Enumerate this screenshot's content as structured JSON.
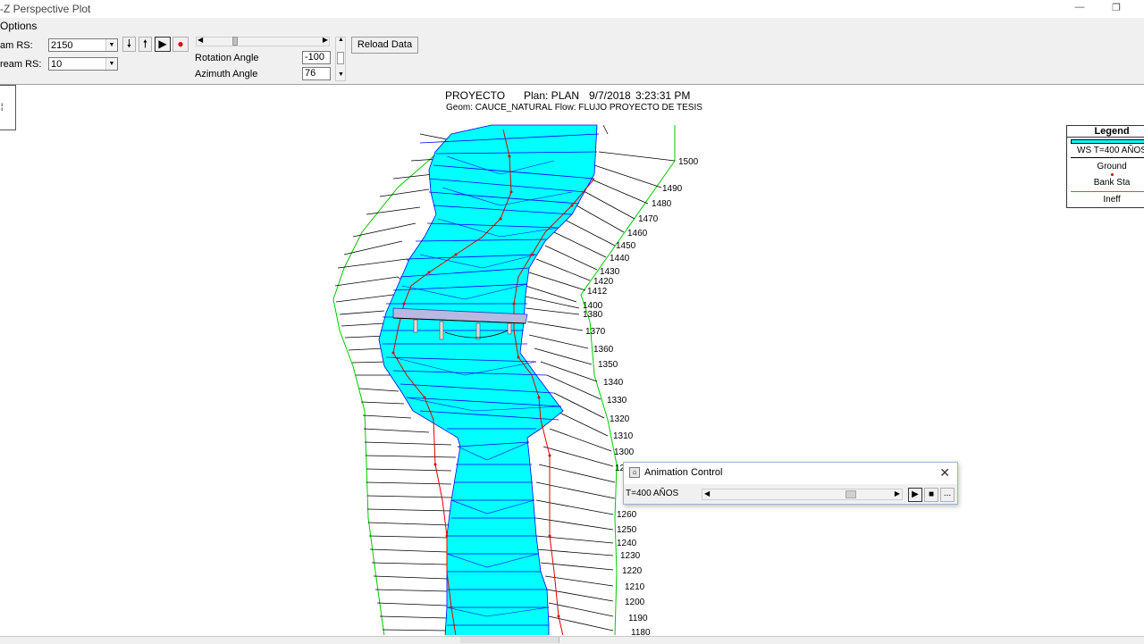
{
  "window": {
    "title": "-Z Perspective Plot",
    "min_glyph": "—",
    "restore_glyph": "❐"
  },
  "menu": {
    "options_label": "Options"
  },
  "toolbar": {
    "upstream_label": "am RS:",
    "upstream_value": "2150",
    "downstream_label": "ream RS:",
    "downstream_value": "10",
    "rotation_label": "Rotation Angle",
    "rotation_value": "-100",
    "azimuth_label": "Azimuth Angle",
    "azimuth_value": "76",
    "reload_label": "Reload Data",
    "down_arrow_glyph": "🠗",
    "up_arrow_glyph": "🠕",
    "play_glyph": "▶",
    "record_glyph": "●"
  },
  "left_box": {
    "text": "¦"
  },
  "plot": {
    "title_line1_project": "PROYECTO",
    "title_line1_plan": "Plan: PLAN",
    "title_line1_date": "9/7/2018",
    "title_line1_time": "3:23:31 PM",
    "title_line2": "Geom: CAUCE_NATURAL   Flow: FLUJO  PROYECTO DE TESIS",
    "station_labels": [
      "1500",
      "1490",
      "1480",
      "1470",
      "1460",
      "1450",
      "1440",
      "1430",
      "1420",
      "1412",
      "1400",
      "1380",
      "1370",
      "1360",
      "1350",
      "1340",
      "1330",
      "1320",
      "1310",
      "1300",
      "12",
      "1260",
      "1250",
      "1240",
      "1230",
      "1220",
      "1210",
      "1200",
      "1190",
      "1180"
    ],
    "colors": {
      "water": "#00ffff",
      "water_lines": "#0000ff",
      "bank": "#ff0000",
      "ineff": "#00cc00",
      "ground": "#000000",
      "bridge": "#9999cc"
    }
  },
  "legend": {
    "title": "Legend",
    "items": [
      "WS T=400 AÑOS",
      "Ground",
      "Bank Sta",
      "Ineff"
    ]
  },
  "animation": {
    "title": "Animation Control",
    "close_glyph": "✕",
    "profile_label": "T=400 AÑOS",
    "play_glyph": "▶",
    "stop_glyph": "■",
    "more_glyph": "..."
  }
}
